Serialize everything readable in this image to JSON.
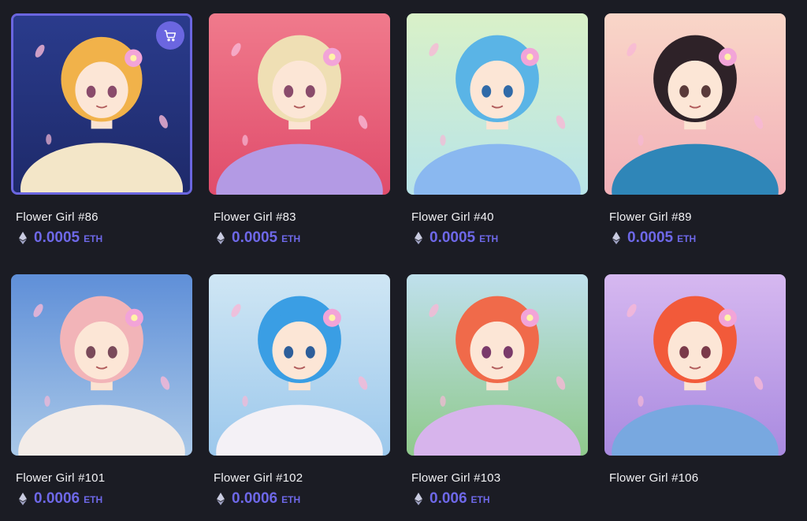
{
  "icons": {
    "cart": "cart-icon",
    "currency": "eth-icon"
  },
  "colors": {
    "accent": "#6e68e8",
    "background": "#1b1c24"
  },
  "items": [
    {
      "name": "Flower Girl #86",
      "price": "0.0005",
      "unit": "ETH",
      "selected": true,
      "bg": [
        "#2a3b8c",
        "#1e2a6a"
      ],
      "hair": "#f1b24a",
      "dress": "#f3e6c8",
      "eyes": "#8a4b6b"
    },
    {
      "name": "Flower Girl #83",
      "price": "0.0005",
      "unit": "ETH",
      "selected": false,
      "bg": [
        "#f07a8c",
        "#e04c6b"
      ],
      "hair": "#efdfb4",
      "dress": "#b39ae4",
      "eyes": "#8a4b6b"
    },
    {
      "name": "Flower Girl #40",
      "price": "0.0005",
      "unit": "ETH",
      "selected": false,
      "bg": [
        "#d9f1c8",
        "#b8e4e8"
      ],
      "hair": "#5ab4e6",
      "dress": "#8ab8f0",
      "eyes": "#2f6aa8"
    },
    {
      "name": "Flower Girl #89",
      "price": "0.0005",
      "unit": "ETH",
      "selected": false,
      "bg": [
        "#f9d6c8",
        "#f2b0b8"
      ],
      "hair": "#2e2228",
      "dress": "#2f86b8",
      "eyes": "#5a3a3a"
    },
    {
      "name": "Flower Girl #101",
      "price": "0.0006",
      "unit": "ETH",
      "selected": false,
      "bg": [
        "#5f8fd8",
        "#a9c8e8"
      ],
      "hair": "#f2b4b8",
      "dress": "#f3ece8",
      "eyes": "#7a4a5a"
    },
    {
      "name": "Flower Girl #102",
      "price": "0.0006",
      "unit": "ETH",
      "selected": false,
      "bg": [
        "#cfe6f4",
        "#9cc8ec"
      ],
      "hair": "#3a9ee4",
      "dress": "#f4f1f6",
      "eyes": "#2d5e9a"
    },
    {
      "name": "Flower Girl #103",
      "price": "0.006",
      "unit": "ETH",
      "selected": false,
      "bg": [
        "#bfe0ec",
        "#8fc98c"
      ],
      "hair": "#f06a4a",
      "dress": "#d7b4ec",
      "eyes": "#7a3a6a"
    },
    {
      "name": "Flower Girl #106",
      "price": "",
      "unit": "",
      "selected": false,
      "bg": [
        "#d6b8f0",
        "#a98ae0"
      ],
      "hair": "#f25a3a",
      "dress": "#78a8e0",
      "eyes": "#7a3a4a"
    }
  ]
}
